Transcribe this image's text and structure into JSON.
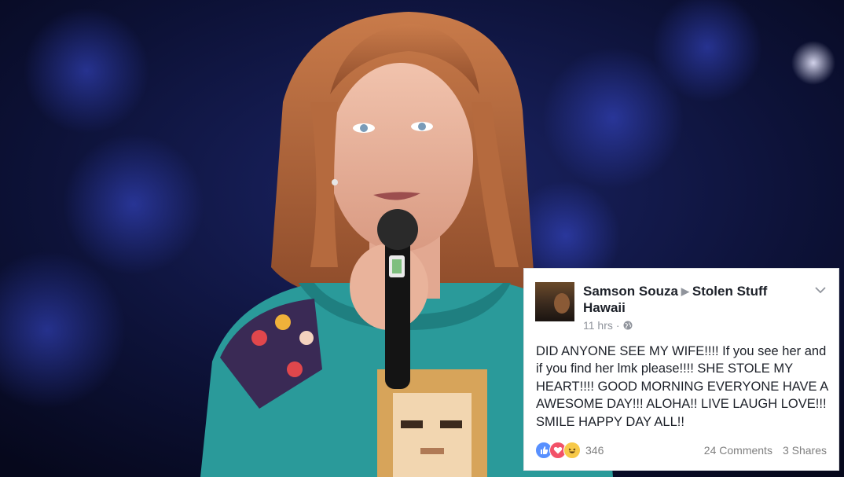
{
  "post": {
    "author": "Samson Souza",
    "group": "Stolen Stuff Hawaii",
    "time": "11 hrs",
    "separator": "·",
    "body": "DID ANYONE SEE MY WIFE!!!! If you see her and if you find her lmk please!!!!  SHE STOLE MY HEART!!!! GOOD MORNING EVERYONE HAVE A AWESOME DAY!!! ALOHA!! LIVE LAUGH LOVE!!! SMILE HAPPY DAY ALL!!",
    "reaction_count": "346",
    "comments": "24 Comments",
    "shares": "3 Shares",
    "icons": {
      "options": "chevron-down-icon",
      "privacy": "globe-icon",
      "reactions": [
        "like-icon",
        "love-icon",
        "haha-icon"
      ]
    }
  },
  "colors": {
    "name_text": "#1d2129",
    "meta_text": "#90949c",
    "like": "#5890ff",
    "love": "#f25268",
    "haha": "#f7c948"
  }
}
